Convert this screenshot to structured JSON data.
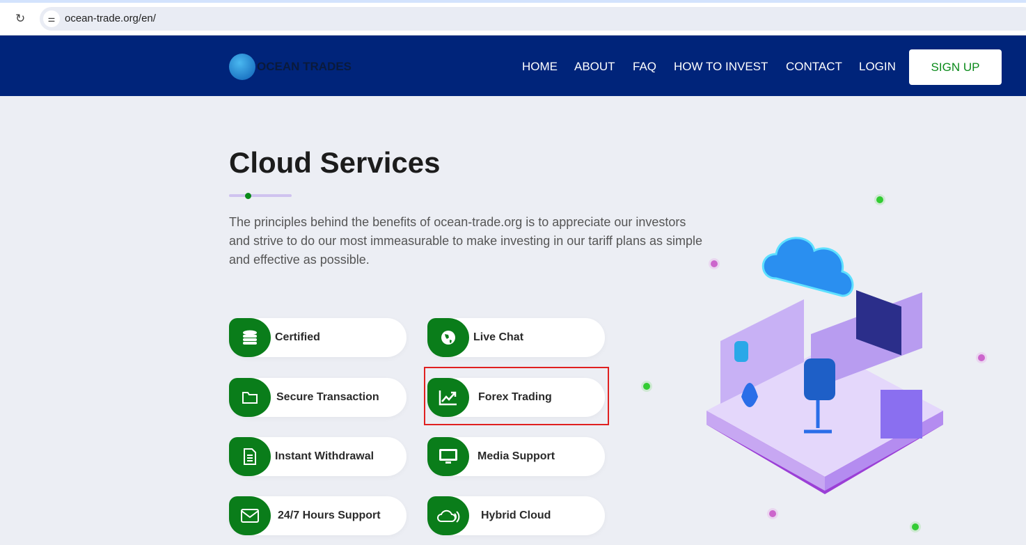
{
  "browser": {
    "url": "ocean-trade.org/en/"
  },
  "nav": {
    "logo": "OCEAN TRADES",
    "items": [
      "HOME",
      "ABOUT",
      "FAQ",
      "HOW TO INVEST",
      "CONTACT",
      "LOGIN"
    ],
    "signup": "SIGN UP"
  },
  "main": {
    "title": "Cloud Services",
    "description": "The principles behind the benefits of ocean-trade.org is to appreciate our investors and strive to do our most immeasurable to make investing in our tariff plans as simple and effective as possible.",
    "features": [
      {
        "label": "Certified",
        "icon": "database-icon"
      },
      {
        "label": "Live Chat",
        "icon": "globe-icon"
      },
      {
        "label": "Secure Transaction",
        "icon": "folder-icon"
      },
      {
        "label": "Forex Trading",
        "icon": "chart-line-icon"
      },
      {
        "label": "Instant Withdrawal",
        "icon": "document-icon"
      },
      {
        "label": "Media Support",
        "icon": "monitor-icon"
      },
      {
        "label": "24/7 Hours Support",
        "icon": "envelope-icon"
      },
      {
        "label": "Hybrid Cloud",
        "icon": "cloud-icon"
      }
    ]
  },
  "colors": {
    "nav": "#00247a",
    "accent": "#0a7d1a"
  }
}
